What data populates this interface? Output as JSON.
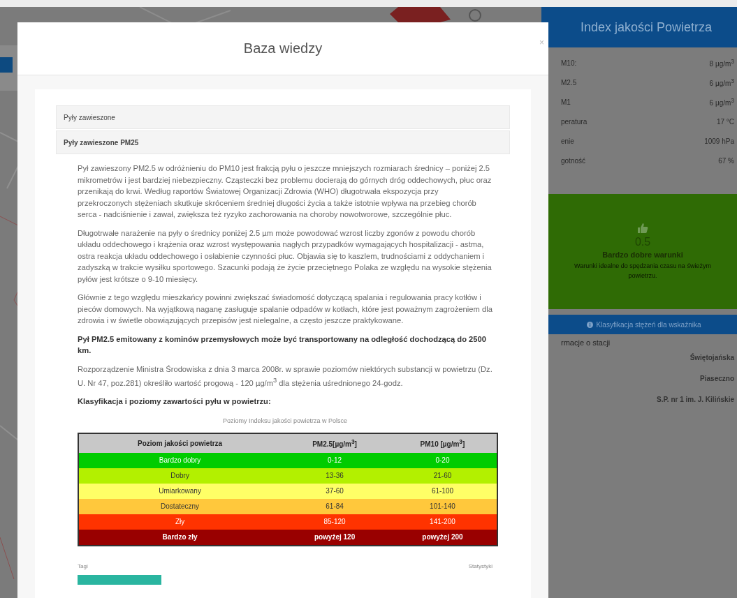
{
  "station_panel": {
    "title": "Index jakości Powietrza",
    "readings": [
      {
        "label": "M10:",
        "value": "8 µg/m$^{3}$"
      },
      {
        "label": "M2.5",
        "value": "6 µg/m$^{3}$"
      },
      {
        "label": "M1",
        "value": "6 µg/m$^{3}$"
      },
      {
        "label": "peratura",
        "value": "17 °C"
      },
      {
        "label": "enie",
        "value": "1009 hPa"
      },
      {
        "label": "gotność",
        "value": "67 %"
      }
    ],
    "status": {
      "score": "0.5",
      "title": "Bardzo dobre warunki",
      "description": "Warunki idealne do spędzania czasu na świeżym powietrzu.",
      "color": "#2f6b05"
    },
    "classification_button": "Klasyfikacja stężeń dla wskaźnika",
    "info_heading": "rmacje o stacji",
    "info_rows": [
      {
        "value": "Świętojańska"
      },
      {
        "value": "Piaseczno"
      },
      {
        "value": "S.P. nr 1 im. J. Kilińskie"
      }
    ]
  },
  "modal": {
    "title": "Baza wiedzy",
    "close": "×",
    "accordion": [
      {
        "title": "Pyły zawieszone",
        "expanded": false
      },
      {
        "title": "Pyły zawieszone PM25",
        "expanded": true,
        "content": {
          "blocks": [
            {
              "kind": "text",
              "text": "Pył zawieszony PM2.5 w odróżnieniu do PM10 jest frakcją pyłu o jeszcze mniejszych rozmiarach średnicy – poniżej 2.5 mikrometrów i jest bardziej niebezpieczny. Cząsteczki bez problemu docierają do górnych dróg oddechowych, płuc oraz przenikają do krwi. Według raportów Światowej Organizacji Zdrowia (WHO) długotrwała ekspozycja przy przekroczonych stężeniach skutkuje skróceniem średniej długości życia a także istotnie wpływa na przebieg chorób serca - nadciśnienie i zawał, zwiększa też ryzyko zachorowania na choroby nowotworowe, szczególnie płuc."
            },
            {
              "kind": "text",
              "text": "Długotrwałe narażenie na pyły o średnicy poniżej 2.5 µm może powodować wzrost liczby zgonów z powodu chorób układu oddechowego i krążenia oraz wzrost występowania nagłych przypadków wymagających hospitalizacji - astma, ostra reakcja układu oddechowego i osłabienie czynności płuc. Objawia się to kaszlem, trudnościami z oddychaniem i zadyszką w trakcie wysiłku sportowego. Szacunki podają że życie przeciętnego Polaka ze względu na wysokie stężenia pyłów jest krótsze o 9-10 miesięcy."
            },
            {
              "kind": "text",
              "text": "Głównie z tego względu mieszkańcy powinni zwiększać świadomość dotyczącą spalania i regulowania pracy kotłów i pieców domowych. Na wyjątkową naganę zasługuje spalanie odpadów w kotłach, które jest poważnym zagrożeniem dla zdrowia i w świetle obowiązujących przepisów jest nielegalne, a często jeszcze praktykowane."
            },
            {
              "kind": "bold",
              "text": "Pył PM2.5 emitowany z kominów przemysłowych może być transportowany na odległość dochodzącą do 2500 km."
            },
            {
              "kind": "text",
              "text": "Rozporządzenie Ministra Środowiska z dnia 3 marca 2008r. w sprawie poziomów niektórych substancji w powietrzu (Dz. U. Nr 47, poz.281) określiło wartość progową - 120 µg/m$^{3}$ dla stężenia uśrednionego 24-godz."
            },
            {
              "kind": "bold",
              "text": "Klasyfikacja i poziomy zawartości pyłu w powietrzu:"
            }
          ],
          "caption": "Poziomy Indeksu jakości powietrza w Polsce",
          "table": {
            "columns": [
              "Poziom jakości powietrza",
              "PM2.5[µg/m$^{3}$]",
              "PM10 [µg/m$^{3}$]"
            ],
            "rows": [
              {
                "cells": [
                  "Bardzo dobry",
                  "0-12",
                  "0-20"
                ],
                "color": "#00cc00"
              },
              {
                "cells": [
                  "Dobry",
                  "13-36",
                  "21-60"
                ],
                "color": "#b3f000"
              },
              {
                "cells": [
                  "Umiarkowany",
                  "37-60",
                  "61-100"
                ],
                "color": "#ffff66"
              },
              {
                "cells": [
                  "Dostateczny",
                  "61-84",
                  "101-140"
                ],
                "color": "#ffc83c"
              },
              {
                "cells": [
                  "Zły",
                  "85-120",
                  "141-200"
                ],
                "color": "#ff3300"
              },
              {
                "cells": [
                  "Bardzo zły",
                  "powyżej 120",
                  "powyżej 200"
                ],
                "color": "#990000"
              }
            ]
          }
        }
      }
    ],
    "footer": {
      "tags_label": "Tagi",
      "stats_label": "Statystyki"
    }
  }
}
